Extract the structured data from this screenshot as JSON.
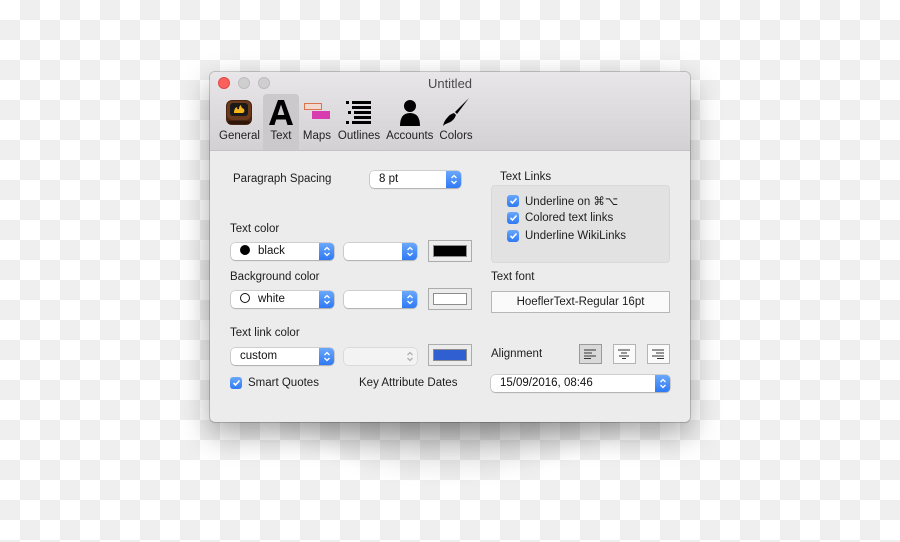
{
  "window": {
    "title": "Untitled",
    "traffic_lights": [
      "close",
      "minimize",
      "zoom"
    ]
  },
  "toolbar": {
    "items": [
      {
        "label": "General",
        "icon": "app-icon",
        "active": false
      },
      {
        "label": "Text",
        "icon": "letter-a-icon",
        "active": true
      },
      {
        "label": "Maps",
        "icon": "maps-icon",
        "active": false
      },
      {
        "label": "Outlines",
        "icon": "outline-list-icon",
        "active": false
      },
      {
        "label": "Accounts",
        "icon": "person-icon",
        "active": false
      },
      {
        "label": "Colors",
        "icon": "paintbrush-icon",
        "active": false
      }
    ]
  },
  "paragraph_spacing": {
    "label": "Paragraph Spacing",
    "value": "8 pt"
  },
  "text_color": {
    "label": "Text color",
    "value": "black",
    "secondary_value": "",
    "swatch": "#000000"
  },
  "background_color": {
    "label": "Background color",
    "value": "white",
    "secondary_value": "",
    "swatch": "#ffffff"
  },
  "text_link_color": {
    "label": "Text link color",
    "value": "custom",
    "secondary_value": "",
    "swatch": "#2f5fd0"
  },
  "smart_quotes": {
    "label": "Smart Quotes",
    "checked": true
  },
  "key_attribute_dates": {
    "label": "Key Attribute Dates",
    "value": "15/09/2016, 08:46"
  },
  "text_links": {
    "label": "Text Links",
    "options": [
      {
        "label": "Underline on ⌘⌥",
        "checked": true
      },
      {
        "label": "Colored text links",
        "checked": true
      },
      {
        "label": "Underline WikiLinks",
        "checked": true
      }
    ]
  },
  "text_font": {
    "label": "Text font",
    "value": "HoeflerText-Regular 16pt"
  },
  "alignment": {
    "label": "Alignment",
    "options": [
      "left",
      "center",
      "right"
    ],
    "selected": "left"
  },
  "colors": {
    "accent": "#3b82f6",
    "close_button": "#fc605c"
  }
}
